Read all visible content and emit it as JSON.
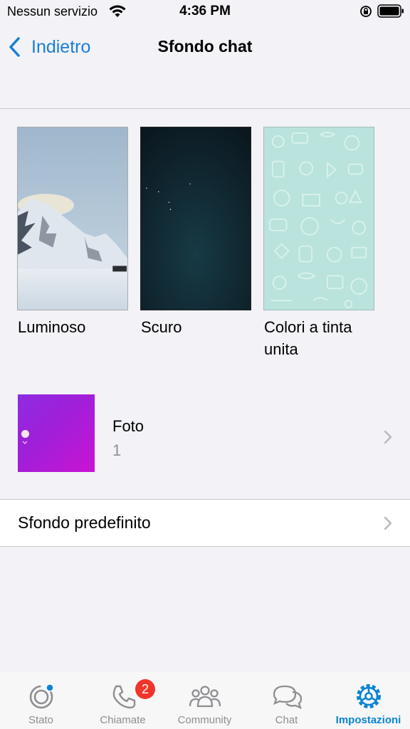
{
  "status_bar": {
    "carrier": "Nessun servizio",
    "time": "4:36 PM",
    "icons": [
      "wifi-icon",
      "orientation-lock-icon",
      "battery-icon"
    ]
  },
  "nav": {
    "back_label": "Indietro",
    "title": "Sfondo chat"
  },
  "wallpapers": [
    {
      "label": "Luminoso"
    },
    {
      "label": "Scuro"
    },
    {
      "label": "Colori a tinta unita"
    }
  ],
  "photo": {
    "title": "Foto",
    "count": "1"
  },
  "default_row": {
    "label": "Sfondo predefinito"
  },
  "tabbar": {
    "active": "Impostazioni",
    "accent_color": "#0a84d6",
    "items": [
      {
        "label": "Stato",
        "icon": "status-icon"
      },
      {
        "label": "Chiamate",
        "icon": "phone-icon",
        "badge": "2"
      },
      {
        "label": "Community",
        "icon": "community-icon"
      },
      {
        "label": "Chat",
        "icon": "chat-bubbles-icon"
      },
      {
        "label": "Impostazioni",
        "icon": "settings-gear-icon"
      }
    ]
  }
}
